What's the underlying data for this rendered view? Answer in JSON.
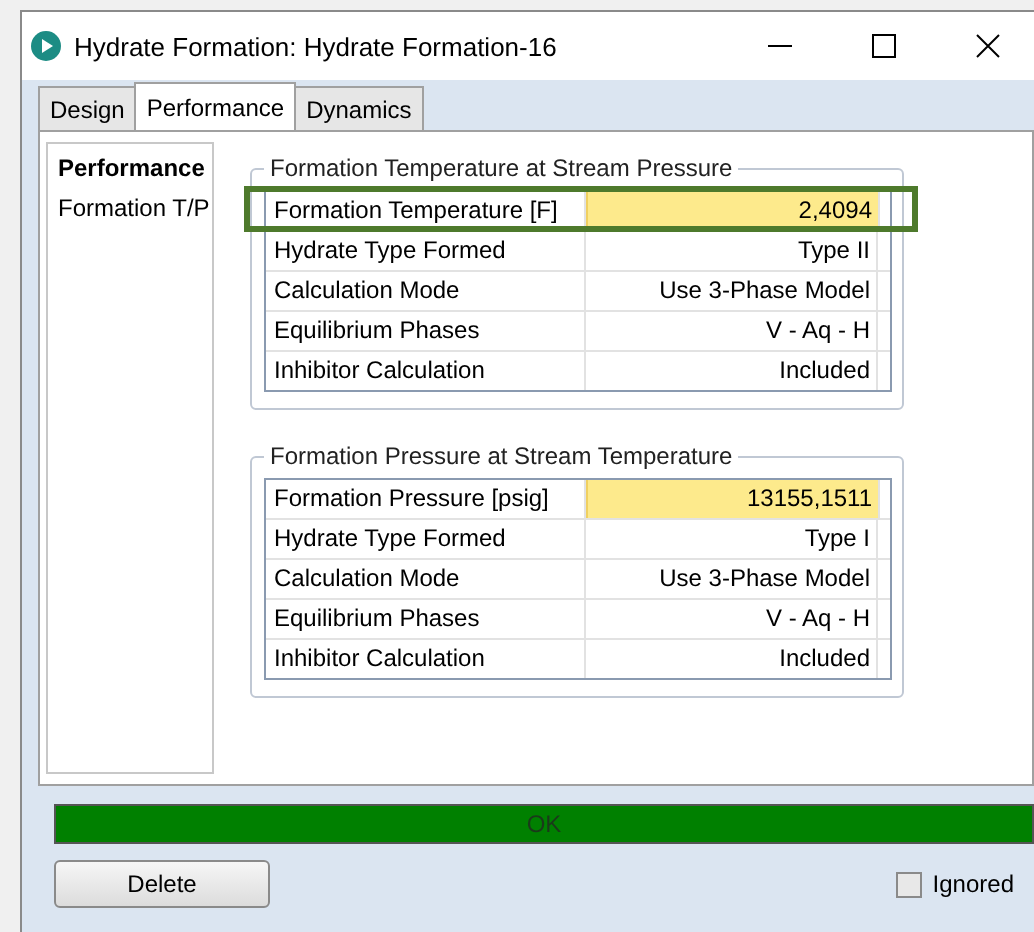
{
  "window": {
    "title": "Hydrate Formation: Hydrate Formation-16"
  },
  "tabs": [
    {
      "label": "Design",
      "selected": false
    },
    {
      "label": "Performance",
      "selected": true
    },
    {
      "label": "Dynamics",
      "selected": false
    }
  ],
  "sidebar": {
    "items": [
      {
        "label": "Performance",
        "selected": true
      },
      {
        "label": "Formation T/P",
        "selected": false
      }
    ]
  },
  "groups": [
    {
      "title": "Formation Temperature at Stream Pressure",
      "rows": [
        {
          "label": "Formation Temperature [F]",
          "value": "2,4094",
          "highlighted": true,
          "annotated": true
        },
        {
          "label": "Hydrate Type Formed",
          "value": "Type II",
          "highlighted": false,
          "annotated": false
        },
        {
          "label": "Calculation Mode",
          "value": "Use 3-Phase Model",
          "highlighted": false,
          "annotated": false
        },
        {
          "label": "Equilibrium Phases",
          "value": "V - Aq - H",
          "highlighted": false,
          "annotated": false
        },
        {
          "label": "Inhibitor Calculation",
          "value": "Included",
          "highlighted": false,
          "annotated": false
        }
      ]
    },
    {
      "title": "Formation Pressure at Stream Temperature",
      "rows": [
        {
          "label": "Formation Pressure [psig]",
          "value": "13155,1511",
          "highlighted": true,
          "annotated": false
        },
        {
          "label": "Hydrate Type Formed",
          "value": "Type I",
          "highlighted": false,
          "annotated": false
        },
        {
          "label": "Calculation Mode",
          "value": "Use 3-Phase Model",
          "highlighted": false,
          "annotated": false
        },
        {
          "label": "Equilibrium Phases",
          "value": "V - Aq - H",
          "highlighted": false,
          "annotated": false
        },
        {
          "label": "Inhibitor Calculation",
          "value": "Included",
          "highlighted": false,
          "annotated": false
        }
      ]
    }
  ],
  "status_bar": {
    "text": "OK",
    "kind": "ok"
  },
  "buttons": [
    "Delete"
  ],
  "ignored": {
    "label": "Ignored",
    "checked": false
  }
}
